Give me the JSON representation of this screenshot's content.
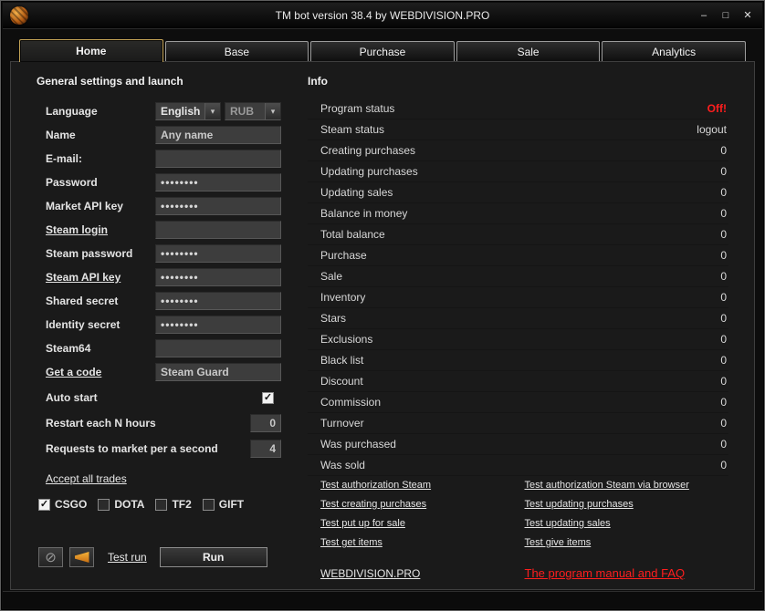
{
  "window": {
    "title": "TM bot version 38.4 by WEBDIVISION.PRO",
    "minimize": "–",
    "maximize": "□",
    "close": "✕"
  },
  "icons": {
    "chevron_down": "▾",
    "check": "✓",
    "no_sign": "⊘"
  },
  "colors": {
    "accent_gold": "#c3a255",
    "status_off_red": "#ff1e1e",
    "horn_orange": "#e08a1e"
  },
  "tabs": [
    {
      "label": "Home",
      "active": true
    },
    {
      "label": "Base",
      "active": false
    },
    {
      "label": "Purchase",
      "active": false
    },
    {
      "label": "Sale",
      "active": false
    },
    {
      "label": "Analytics",
      "active": false
    }
  ],
  "settings": {
    "heading": "General settings and launch",
    "language": {
      "label": "Language",
      "value": "English",
      "currency": "RUB"
    },
    "fields": [
      {
        "name": "name",
        "label": "Name",
        "type": "text",
        "value": "Any name",
        "link": false
      },
      {
        "name": "email",
        "label": "E-mail:",
        "type": "text",
        "value": "",
        "link": false
      },
      {
        "name": "password",
        "label": "Password",
        "type": "password",
        "value": "••••••••",
        "link": false
      },
      {
        "name": "market-api-key",
        "label": "Market API key",
        "type": "password",
        "value": "••••••••",
        "link": false
      },
      {
        "name": "steam-login",
        "label": "Steam login",
        "type": "text",
        "value": "",
        "link": true
      },
      {
        "name": "steam-password",
        "label": "Steam password",
        "type": "password",
        "value": "••••••••",
        "link": false
      },
      {
        "name": "steam-api-key",
        "label": "Steam API key",
        "type": "password",
        "value": "••••••••",
        "link": true
      },
      {
        "name": "shared-secret",
        "label": "Shared secret",
        "type": "password",
        "value": "••••••••",
        "link": false
      },
      {
        "name": "identity-secret",
        "label": "Identity secret",
        "type": "password",
        "value": "••••••••",
        "link": false
      },
      {
        "name": "steam64",
        "label": "Steam64",
        "type": "text",
        "value": "",
        "link": false
      },
      {
        "name": "get-a-code",
        "label": "Get a code",
        "type": "text",
        "value": "Steam Guard",
        "link": true
      }
    ],
    "auto_start": {
      "label": "Auto start",
      "checked": true
    },
    "restart": {
      "label": "Restart each N hours",
      "value": "0"
    },
    "requests": {
      "label": "Requests to market per a second",
      "value": "4"
    },
    "accept_all_trades_label": "Accept all trades",
    "games": [
      {
        "label": "CSGO",
        "checked": true
      },
      {
        "label": "DOTA",
        "checked": false
      },
      {
        "label": "TF2",
        "checked": false
      },
      {
        "label": "GIFT",
        "checked": false
      }
    ],
    "test_run_label": "Test run",
    "run_label": "Run"
  },
  "info": {
    "heading": "Info",
    "rows": [
      {
        "label": "Program status",
        "value": "Off!",
        "status": "off"
      },
      {
        "label": "Steam status",
        "value": "logout",
        "status": ""
      },
      {
        "label": "Creating purchases",
        "value": "0",
        "status": ""
      },
      {
        "label": "Updating purchases",
        "value": "0",
        "status": ""
      },
      {
        "label": "Updating sales",
        "value": "0",
        "status": ""
      },
      {
        "label": "Balance in money",
        "value": "0",
        "status": ""
      },
      {
        "label": "Total balance",
        "value": "0",
        "status": ""
      },
      {
        "label": "Purchase",
        "value": "0",
        "status": ""
      },
      {
        "label": "Sale",
        "value": "0",
        "status": ""
      },
      {
        "label": "Inventory",
        "value": "0",
        "status": ""
      },
      {
        "label": "Stars",
        "value": "0",
        "status": ""
      },
      {
        "label": "Exclusions",
        "value": "0",
        "status": ""
      },
      {
        "label": "Black list",
        "value": "0",
        "status": ""
      },
      {
        "label": "Discount",
        "value": "0",
        "status": ""
      },
      {
        "label": "Commission",
        "value": "0",
        "status": ""
      },
      {
        "label": "Turnover",
        "value": "0",
        "status": ""
      },
      {
        "label": "Was purchased",
        "value": "0",
        "status": ""
      },
      {
        "label": "Was sold",
        "value": "0",
        "status": ""
      }
    ],
    "links": [
      {
        "left": "Test authorization Steam",
        "right": "Test authorization Steam via browser"
      },
      {
        "left": "Test creating purchases",
        "right": "Test updating purchases"
      },
      {
        "left": "Test put up for sale",
        "right": "Test updating sales"
      },
      {
        "left": "Test get items",
        "right": "Test give items"
      }
    ],
    "footer": {
      "site": "WEBDIVISION.PRO",
      "manual": "The program manual and FAQ"
    }
  }
}
